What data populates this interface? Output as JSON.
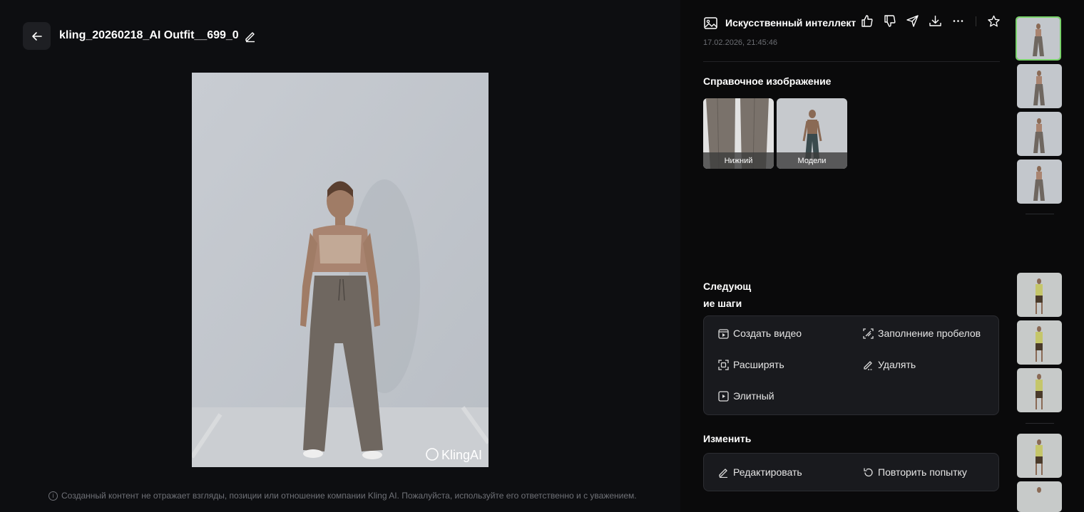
{
  "header": {
    "file_title": "kling_20260218_AI Outfit__699_0"
  },
  "disclaimer": "Созданный контент не отражает взгляды, позиции или отношение компании Kling AI. Пожалуйста, используйте его ответственно и с уважением.",
  "main_image": {
    "watermark": "KlingAI",
    "subject": "woman in beige crop top and grey wide-leg sweatpants standing against light grey wall"
  },
  "info_panel": {
    "title": "Искусственный интеллект",
    "timestamp": "17.02.2026, 21:45:46",
    "icons": [
      "image-icon",
      "thumbs-up-icon",
      "thumbs-down-icon",
      "send-icon",
      "download-icon",
      "more-icon",
      "star-icon"
    ]
  },
  "reference": {
    "title": "Справочное изображение",
    "items": [
      {
        "label": "Нижний"
      },
      {
        "label": "Модели"
      }
    ]
  },
  "next_steps": {
    "title_line1": "Следующ",
    "title_line2": "ие шаги",
    "actions": [
      {
        "label": "Создать видео",
        "icon": "video-create-icon"
      },
      {
        "label": "Заполнение пробелов",
        "icon": "inpaint-icon"
      },
      {
        "label": "Расширять",
        "icon": "expand-icon"
      },
      {
        "label": "Удалять",
        "icon": "erase-icon"
      },
      {
        "label": "Элитный",
        "icon": "elite-icon"
      }
    ]
  },
  "edit": {
    "title": "Изменить",
    "actions": [
      {
        "label": "Редактировать",
        "icon": "pencil-icon"
      },
      {
        "label": "Повторить попытку",
        "icon": "retry-icon"
      }
    ]
  },
  "colors": {
    "accent_active_border": "#7ad36b",
    "panel_bg": "#191a1e",
    "page_bg": "#0d0e11"
  }
}
